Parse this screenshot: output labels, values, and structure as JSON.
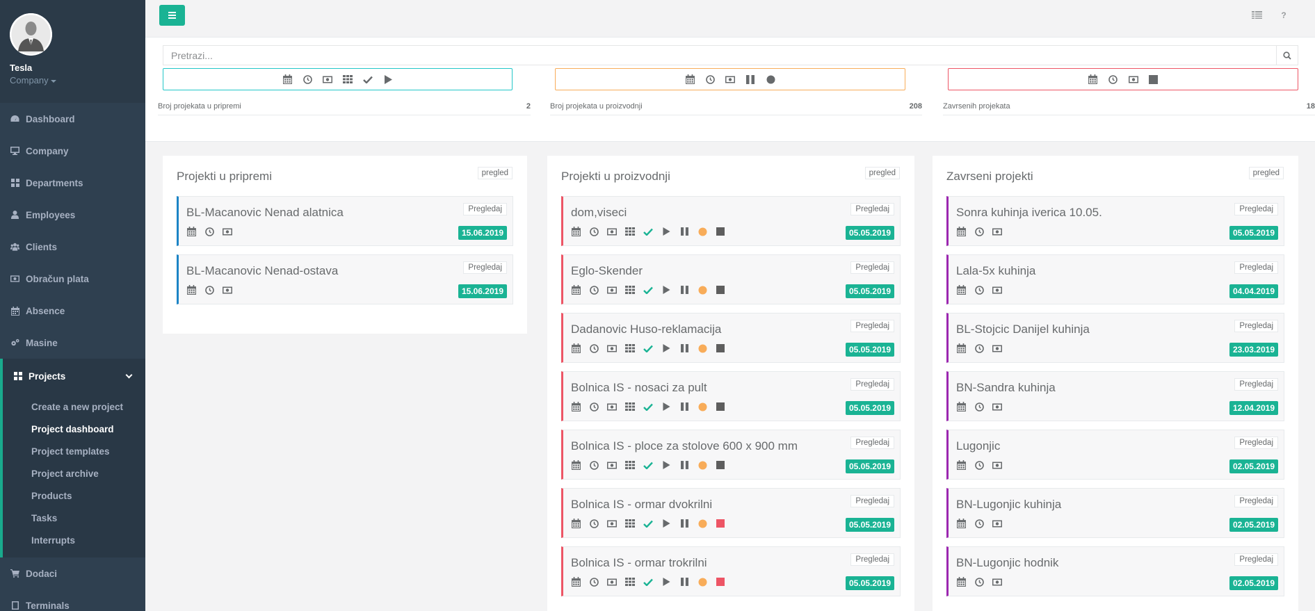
{
  "sidebar": {
    "profile": {
      "name": "Tesla",
      "company": "Company"
    },
    "items": [
      {
        "label": "Dashboard",
        "icon": "dashboard-icon"
      },
      {
        "label": "Company",
        "icon": "desktop-icon"
      },
      {
        "label": "Departments",
        "icon": "grid-icon"
      },
      {
        "label": "Employees",
        "icon": "user-icon"
      },
      {
        "label": "Clients",
        "icon": "users-icon"
      },
      {
        "label": "Obračun plata",
        "icon": "money-icon"
      },
      {
        "label": "Absence",
        "icon": "calendar-icon"
      },
      {
        "label": "Masine",
        "icon": "cogs-icon"
      },
      {
        "label": "Projects",
        "icon": "grid-icon"
      },
      {
        "label": "Dodaci",
        "icon": "cart-icon"
      },
      {
        "label": "Terminals",
        "icon": "tablet-icon"
      }
    ],
    "projects_sub": [
      "Create a new project",
      "Project dashboard",
      "Project templates",
      "Project archive",
      "Products",
      "Tasks",
      "Interrupts"
    ]
  },
  "topbar": {
    "help": "?"
  },
  "search": {
    "placeholder": "Pretrazi..."
  },
  "stats": [
    {
      "label": "Broj projekata u pripremi",
      "value": "2",
      "color": "#23c6c8"
    },
    {
      "label": "Broj projekata u proizvodnji",
      "value": "208",
      "color": "#f8ac59"
    },
    {
      "label": "Zavrsenih projekata",
      "value": "18",
      "color": "#ed5565"
    }
  ],
  "columns": [
    {
      "title": "Projekti u pripremi",
      "badge": "pregled",
      "accent": "#1c84c6",
      "cards": [
        {
          "title": "BL-Macanovic Nenad alatnica",
          "button": "Pregledaj",
          "date": "15.06.2019"
        },
        {
          "title": "BL-Macanovic Nenad-ostava",
          "button": "Pregledaj",
          "date": "15.06.2019"
        }
      ]
    },
    {
      "title": "Projekti u proizvodnji",
      "badge": "pregled",
      "accent": "#ed5565",
      "cards": [
        {
          "title": "dom,viseci",
          "button": "Pregledaj",
          "date": "05.05.2019",
          "stop_color": "#5e5e5e"
        },
        {
          "title": "Eglo-Skender",
          "button": "Pregledaj",
          "date": "05.05.2019",
          "stop_color": "#5e5e5e"
        },
        {
          "title": "Dadanovic Huso-reklamacija",
          "button": "Pregledaj",
          "date": "05.05.2019",
          "stop_color": "#5e5e5e"
        },
        {
          "title": "Bolnica IS - nosaci za pult",
          "button": "Pregledaj",
          "date": "05.05.2019",
          "stop_color": "#5e5e5e"
        },
        {
          "title": "Bolnica IS - ploce za stolove 600 x 900 mm",
          "button": "Pregledaj",
          "date": "05.05.2019",
          "stop_color": "#5e5e5e"
        },
        {
          "title": "Bolnica IS - ormar dvokrilni",
          "button": "Pregledaj",
          "date": "05.05.2019",
          "stop_color": "#ed5565"
        },
        {
          "title": "Bolnica IS - ormar trokrilni",
          "button": "Pregledaj",
          "date": "05.05.2019",
          "stop_color": "#ed5565"
        }
      ]
    },
    {
      "title": "Zavrseni projekti",
      "badge": "pregled",
      "accent": "#9c27b0",
      "cards": [
        {
          "title": "Sonra kuhinja iverica 10.05.",
          "button": "Pregledaj",
          "date": "05.05.2019"
        },
        {
          "title": "Lala-5x kuhinja",
          "button": "Pregledaj",
          "date": "04.04.2019"
        },
        {
          "title": "BL-Stojcic Danijel kuhinja",
          "button": "Pregledaj",
          "date": "23.03.2019"
        },
        {
          "title": "BN-Sandra kuhinja",
          "button": "Pregledaj",
          "date": "12.04.2019"
        },
        {
          "title": "Lugonjic",
          "button": "Pregledaj",
          "date": "02.05.2019"
        },
        {
          "title": "BN-Lugonjic kuhinja",
          "button": "Pregledaj",
          "date": "02.05.2019"
        },
        {
          "title": "BN-Lugonjic hodnik",
          "button": "Pregledaj",
          "date": "02.05.2019"
        }
      ]
    }
  ]
}
